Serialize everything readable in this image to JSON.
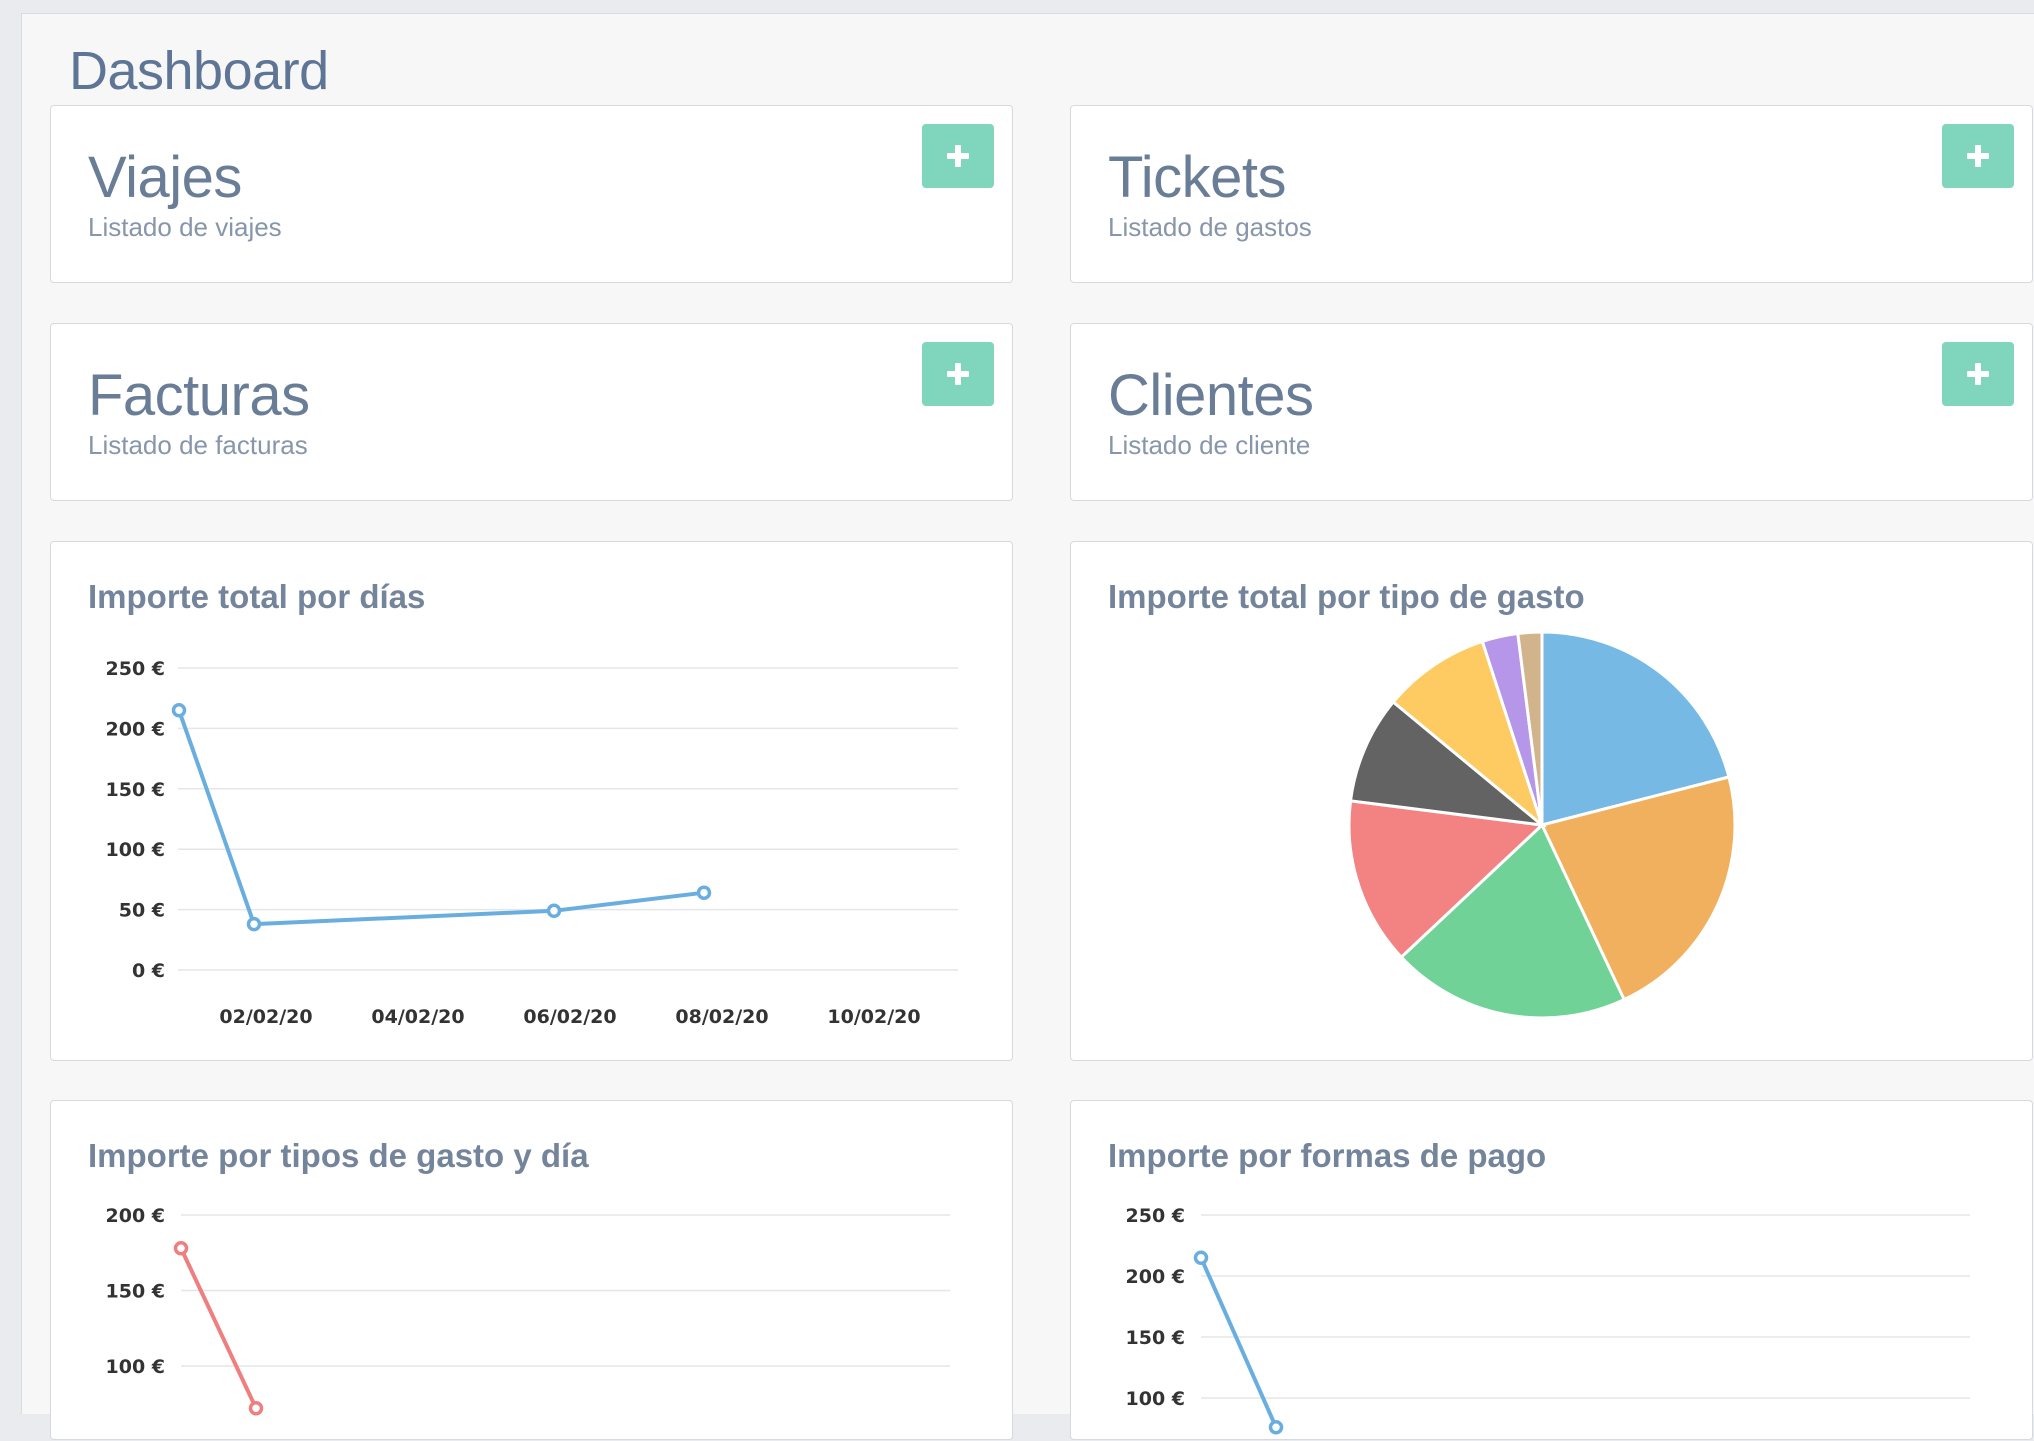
{
  "page": {
    "title": "Dashboard"
  },
  "cards": [
    {
      "title": "Viajes",
      "subtitle": "Listado de viajes",
      "action": "+"
    },
    {
      "title": "Tickets",
      "subtitle": "Listado de gastos",
      "action": "+"
    },
    {
      "title": "Facturas",
      "subtitle": "Listado de facturas",
      "action": "+"
    },
    {
      "title": "Clientes",
      "subtitle": "Listado de cliente",
      "action": "+"
    }
  ],
  "colors": {
    "accent": "#7fd6bd",
    "line_blue": "#6aaee0",
    "line_red": "#ef7f7f"
  },
  "chart_data": [
    {
      "type": "line",
      "title": "Importe total por días",
      "x_tick_labels": [
        "02/02/20",
        "04/02/20",
        "06/02/20",
        "08/02/20",
        "10/02/20"
      ],
      "y_tick_labels": [
        "250 €",
        "200 €",
        "150 €",
        "100 €",
        "50 €",
        "0 €"
      ],
      "ylim": [
        0,
        250
      ],
      "series": [
        {
          "color": "#6aaee0",
          "points": [
            {
              "x": "2020-02-01",
              "y": 215
            },
            {
              "x": "2020-02-02",
              "y": 38
            },
            {
              "x": "2020-02-06",
              "y": 49
            },
            {
              "x": "2020-02-08",
              "y": 64
            }
          ]
        }
      ],
      "grid": true
    },
    {
      "type": "pie",
      "title": "Importe total por tipo de gasto",
      "slices": [
        {
          "value": 21,
          "color": "#77b9e5"
        },
        {
          "value": 22,
          "color": "#f1b05e"
        },
        {
          "value": 20,
          "color": "#70d296"
        },
        {
          "value": 14,
          "color": "#f38383"
        },
        {
          "value": 9,
          "color": "#636363"
        },
        {
          "value": 9,
          "color": "#fecb63"
        },
        {
          "value": 3,
          "color": "#b596e8"
        },
        {
          "value": 2,
          "color": "#d2b48c"
        }
      ]
    },
    {
      "type": "line",
      "title": "Importe por tipos de gasto y día",
      "y_tick_labels": [
        "200 €",
        "150 €",
        "100 €"
      ],
      "ylim_visible": [
        100,
        200
      ],
      "series": [
        {
          "color": "#ef7f7f",
          "points": [
            {
              "x": "2020-02-01",
              "y": 178
            },
            {
              "x": "2020-02-02",
              "y": 72
            }
          ]
        }
      ],
      "grid": true
    },
    {
      "type": "line",
      "title": "Importe por formas de pago",
      "y_tick_labels": [
        "250 €",
        "200 €",
        "150 €",
        "100 €"
      ],
      "ylim_visible": [
        100,
        250
      ],
      "series": [
        {
          "color": "#6aaee0",
          "points": [
            {
              "x": "2020-02-01",
              "y": 215
            },
            {
              "x": "2020-02-02",
              "y": 76
            }
          ]
        }
      ],
      "grid": true
    }
  ]
}
